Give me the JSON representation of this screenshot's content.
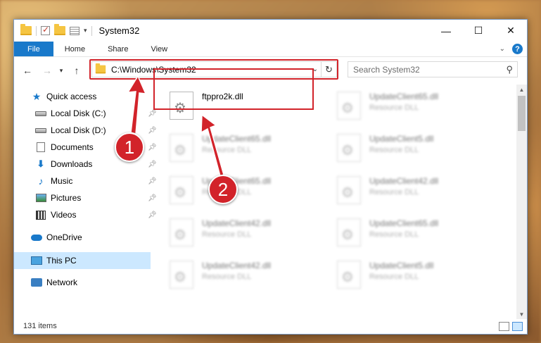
{
  "window": {
    "title": "System32",
    "controls": [
      "minimize",
      "maximize",
      "close"
    ]
  },
  "ribbon": {
    "tabs": [
      "File",
      "Home",
      "Share",
      "View"
    ],
    "help": "?"
  },
  "address": {
    "path": "C:\\Windows\\System32",
    "search_placeholder": "Search System32"
  },
  "nav": {
    "items": [
      {
        "label": "Quick access",
        "icon": "star-icon",
        "pinned": false
      },
      {
        "label": "Local Disk (C:)",
        "icon": "drive-icon",
        "pinned": true
      },
      {
        "label": "Local Disk (D:)",
        "icon": "drive-icon",
        "pinned": true
      },
      {
        "label": "Documents",
        "icon": "documents-icon",
        "pinned": true
      },
      {
        "label": "Downloads",
        "icon": "downloads-icon",
        "pinned": true
      },
      {
        "label": "Music",
        "icon": "music-icon",
        "pinned": true
      },
      {
        "label": "Pictures",
        "icon": "pictures-icon",
        "pinned": true
      },
      {
        "label": "Videos",
        "icon": "videos-icon",
        "pinned": true
      },
      {
        "label": "OneDrive",
        "icon": "onedrive-icon",
        "pinned": false
      },
      {
        "label": "This PC",
        "icon": "this-pc-icon",
        "pinned": false,
        "selected": true
      },
      {
        "label": "Network",
        "icon": "network-icon",
        "pinned": false
      }
    ]
  },
  "files": [
    {
      "name": "ftppro2k.dll",
      "type": "",
      "highlighted": true
    },
    {
      "name": "UpdateClient65.dll",
      "type": "Resource DLL"
    },
    {
      "name": "UpdateClient65.dll",
      "type": "Resource DLL"
    },
    {
      "name": "UpdateClient5.dll",
      "type": "Resource DLL"
    },
    {
      "name": "UpdateClient65.dll",
      "type": "Resource DLL"
    },
    {
      "name": "UpdateClient42.dll",
      "type": "Resource DLL"
    },
    {
      "name": "UpdateClient42.dll",
      "type": "Resource DLL"
    },
    {
      "name": "UpdateClient65.dll",
      "type": "Resource DLL"
    },
    {
      "name": "UpdateClient42.dll",
      "type": "Resource DLL"
    },
    {
      "name": "UpdateClient5.dll",
      "type": "Resource DLL"
    }
  ],
  "status": {
    "item_count": "131 items"
  },
  "callouts": [
    "1",
    "2"
  ],
  "colors": {
    "accent": "#1979ca",
    "highlight": "#d2232a",
    "selection": "#cce8ff"
  }
}
